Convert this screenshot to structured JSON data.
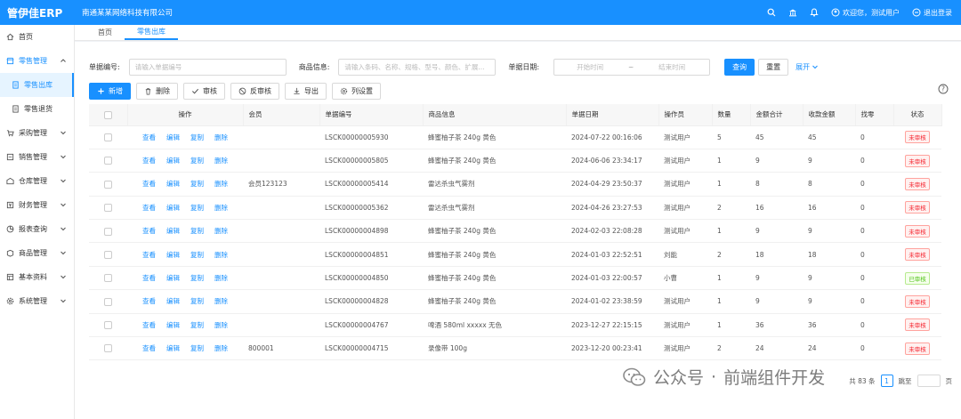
{
  "app": {
    "brand": "管伊佳ERP",
    "company": "南通某某网络科技有限公司",
    "welcome": "欢迎您，测试用户",
    "logout": "退出登录"
  },
  "sidebar": {
    "items": [
      {
        "label": "首页",
        "icon": "home-icon"
      },
      {
        "label": "零售管理",
        "icon": "shop-icon"
      },
      {
        "label": "零售出库",
        "icon": "doc-icon"
      },
      {
        "label": "零售退货",
        "icon": "doc-icon"
      },
      {
        "label": "采购管理",
        "icon": "cart-icon"
      },
      {
        "label": "销售管理",
        "icon": "sales-icon"
      },
      {
        "label": "仓库管理",
        "icon": "warehouse-icon"
      },
      {
        "label": "财务管理",
        "icon": "finance-icon"
      },
      {
        "label": "报表查询",
        "icon": "report-icon"
      },
      {
        "label": "商品管理",
        "icon": "goods-icon"
      },
      {
        "label": "基本资料",
        "icon": "data-icon"
      },
      {
        "label": "系统管理",
        "icon": "gear-icon"
      }
    ]
  },
  "tabs": [
    {
      "label": "首页"
    },
    {
      "label": "零售出库"
    }
  ],
  "search": {
    "bill_no_label": "单据编号:",
    "bill_no_placeholder": "请输入单据编号",
    "goods_label": "商品信息:",
    "goods_placeholder": "请输入条码、名称、规格、型号、颜色、扩展...",
    "date_label": "单据日期:",
    "start_placeholder": "开始时间",
    "date_sep": "~",
    "end_placeholder": "结束时间",
    "query": "查询",
    "reset": "重置",
    "expand": "展开"
  },
  "toolbar": {
    "add": "新增",
    "delete": "删除",
    "audit": "审核",
    "unaudit": "反审核",
    "export": "导出",
    "columns": "列设置"
  },
  "table": {
    "headers": [
      "操作",
      "会员",
      "单据编号",
      "商品信息",
      "单据日期",
      "操作员",
      "数量",
      "金额合计",
      "收款金额",
      "找零",
      "状态"
    ],
    "actions": [
      "查看",
      "编辑",
      "复制",
      "删除"
    ],
    "rows": [
      {
        "member": "",
        "no": "LSCK00000005930",
        "goods": "蜂蜜柚子茶 240g 黄色",
        "date": "2024-07-22 00:16:06",
        "operator": "测试用户",
        "qty": "5",
        "total": "45",
        "received": "45",
        "change": "0",
        "status": "未审核"
      },
      {
        "member": "",
        "no": "LSCK00000005805",
        "goods": "蜂蜜柚子茶 240g 黄色",
        "date": "2024-06-06 23:34:17",
        "operator": "测试用户",
        "qty": "1",
        "total": "9",
        "received": "9",
        "change": "0",
        "status": "未审核"
      },
      {
        "member": "会员123123",
        "no": "LSCK00000005414",
        "goods": "雷达杀虫气雾剂",
        "date": "2024-04-29 23:50:37",
        "operator": "测试用户",
        "qty": "1",
        "total": "8",
        "received": "8",
        "change": "0",
        "status": "未审核"
      },
      {
        "member": "",
        "no": "LSCK00000005362",
        "goods": "雷达杀虫气雾剂",
        "date": "2024-04-26 23:27:53",
        "operator": "测试用户",
        "qty": "2",
        "total": "16",
        "received": "16",
        "change": "0",
        "status": "未审核"
      },
      {
        "member": "",
        "no": "LSCK00000004898",
        "goods": "蜂蜜柚子茶 240g 黄色",
        "date": "2024-02-03 22:08:28",
        "operator": "测试用户",
        "qty": "1",
        "total": "9",
        "received": "9",
        "change": "0",
        "status": "未审核"
      },
      {
        "member": "",
        "no": "LSCK00000004851",
        "goods": "蜂蜜柚子茶 240g 黄色",
        "date": "2024-01-03 22:52:51",
        "operator": "刘能",
        "qty": "2",
        "total": "18",
        "received": "18",
        "change": "0",
        "status": "未审核"
      },
      {
        "member": "",
        "no": "LSCK00000004850",
        "goods": "蜂蜜柚子茶 240g 黄色",
        "date": "2024-01-03 22:00:57",
        "operator": "小曹",
        "qty": "1",
        "total": "9",
        "received": "9",
        "change": "0",
        "status": "已审核"
      },
      {
        "member": "",
        "no": "LSCK00000004828",
        "goods": "蜂蜜柚子茶 240g 黄色",
        "date": "2024-01-02 23:38:59",
        "operator": "测试用户",
        "qty": "1",
        "total": "9",
        "received": "9",
        "change": "0",
        "status": "未审核"
      },
      {
        "member": "",
        "no": "LSCK00000004767",
        "goods": "啤酒 580ml xxxxx 无色",
        "date": "2023-12-27 22:15:15",
        "operator": "测试用户",
        "qty": "1",
        "total": "36",
        "received": "36",
        "change": "0",
        "status": "未审核"
      },
      {
        "member": "800001",
        "no": "LSCK00000004715",
        "goods": "录像带 100g",
        "date": "2023-12-20 00:23:41",
        "operator": "测试用户",
        "qty": "2",
        "total": "24",
        "received": "24",
        "change": "0",
        "status": "未审核"
      }
    ]
  },
  "pager": {
    "total": "共 83 条",
    "page": "1",
    "jump": "跳至",
    "unit": "页"
  },
  "watermark": {
    "text1": "公众号",
    "sep": "·",
    "text2": "前端组件开发"
  },
  "colors": {
    "primary": "#1890ff",
    "danger": "#f5222d",
    "success": "#52c41a"
  }
}
